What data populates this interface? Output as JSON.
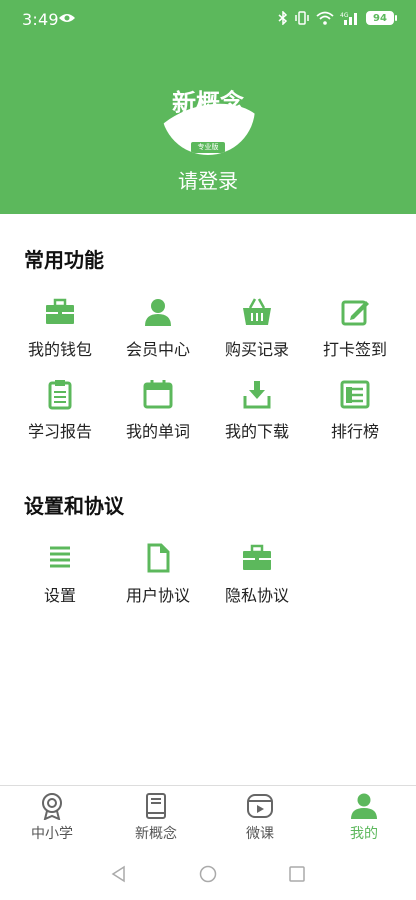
{
  "status_bar": {
    "time": "3:49",
    "battery": "94"
  },
  "header": {
    "logo_text": "新概念",
    "logo_tag": "专业版",
    "login_label": "请登录"
  },
  "common": {
    "title": "常用功能",
    "items": [
      {
        "label": "我的钱包",
        "icon": "wallet-icon"
      },
      {
        "label": "会员中心",
        "icon": "member-icon"
      },
      {
        "label": "购买记录",
        "icon": "basket-icon"
      },
      {
        "label": "打卡签到",
        "icon": "checkin-edit-icon"
      },
      {
        "label": "学习报告",
        "icon": "report-clipboard-icon"
      },
      {
        "label": "我的单词",
        "icon": "calendar-icon"
      },
      {
        "label": "我的下载",
        "icon": "download-icon"
      },
      {
        "label": "排行榜",
        "icon": "ranking-icon"
      }
    ]
  },
  "settings": {
    "title": "设置和协议",
    "items": [
      {
        "label": "设置",
        "icon": "menu-lines-icon"
      },
      {
        "label": "用户协议",
        "icon": "document-icon"
      },
      {
        "label": "隐私协议",
        "icon": "briefcase-icon"
      }
    ]
  },
  "tabs": [
    {
      "label": "中小学",
      "icon": "medal-icon",
      "active": false
    },
    {
      "label": "新概念",
      "icon": "book-icon",
      "active": false
    },
    {
      "label": "微课",
      "icon": "video-icon",
      "active": false
    },
    {
      "label": "我的",
      "icon": "user-icon",
      "active": true
    }
  ],
  "colors": {
    "brand_green": "#5cb85c",
    "text_dark": "#111111"
  }
}
